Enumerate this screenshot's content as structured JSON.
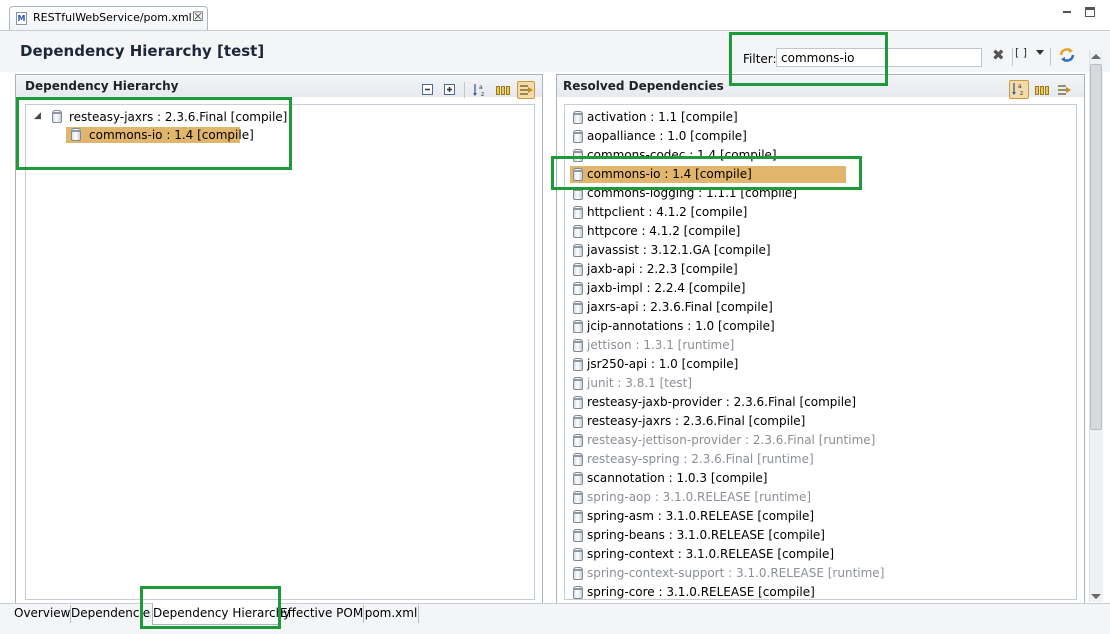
{
  "editor_tab": {
    "title": "RESTfulWebService/pom.xml",
    "icon": "maven-pom-icon",
    "icon_letter": "M",
    "close_glyph": "☒"
  },
  "header": {
    "title": "Dependency Hierarchy [test]",
    "filter_label": "Filter:",
    "filter_value": "commons-io",
    "bracket_glyph": "[ ]"
  },
  "left_panel": {
    "title": "Dependency Hierarchy",
    "tree": [
      {
        "label": "resteasy-jaxrs : 2.3.6.Final [compile]",
        "expanded": true,
        "expander": "◢",
        "selected": false
      },
      {
        "label": "commons-io : 1.4 [compile]",
        "selected": true
      }
    ]
  },
  "right_panel": {
    "title": "Resolved Dependencies",
    "items": [
      {
        "label": "activation : 1.1 [compile]",
        "muted": false
      },
      {
        "label": "aopalliance : 1.0 [compile]",
        "muted": false
      },
      {
        "label": "commons-codec : 1.4 [compile]",
        "muted": false
      },
      {
        "label": "commons-io : 1.4 [compile]",
        "muted": false,
        "selected": true
      },
      {
        "label": "commons-logging : 1.1.1 [compile]",
        "muted": false
      },
      {
        "label": "httpclient : 4.1.2 [compile]",
        "muted": false
      },
      {
        "label": "httpcore : 4.1.2 [compile]",
        "muted": false
      },
      {
        "label": "javassist : 3.12.1.GA [compile]",
        "muted": false
      },
      {
        "label": "jaxb-api : 2.2.3 [compile]",
        "muted": false
      },
      {
        "label": "jaxb-impl : 2.2.4 [compile]",
        "muted": false
      },
      {
        "label": "jaxrs-api : 2.3.6.Final [compile]",
        "muted": false
      },
      {
        "label": "jcip-annotations : 1.0 [compile]",
        "muted": false
      },
      {
        "label": "jettison : 1.3.1 [runtime]",
        "muted": true
      },
      {
        "label": "jsr250-api : 1.0 [compile]",
        "muted": false
      },
      {
        "label": "junit : 3.8.1 [test]",
        "muted": true
      },
      {
        "label": "resteasy-jaxb-provider : 2.3.6.Final [compile]",
        "muted": false
      },
      {
        "label": "resteasy-jaxrs : 2.3.6.Final [compile]",
        "muted": false
      },
      {
        "label": "resteasy-jettison-provider : 2.3.6.Final [runtime]",
        "muted": true
      },
      {
        "label": "resteasy-spring : 2.3.6.Final [runtime]",
        "muted": true
      },
      {
        "label": "scannotation : 1.0.3 [compile]",
        "muted": false
      },
      {
        "label": "spring-aop : 3.1.0.RELEASE [runtime]",
        "muted": true
      },
      {
        "label": "spring-asm : 3.1.0.RELEASE [compile]",
        "muted": false
      },
      {
        "label": "spring-beans : 3.1.0.RELEASE [compile]",
        "muted": false
      },
      {
        "label": "spring-context : 3.1.0.RELEASE [compile]",
        "muted": false
      },
      {
        "label": "spring-context-support : 3.1.0.RELEASE [runtime]",
        "muted": true
      },
      {
        "label": "spring-core : 3.1.0.RELEASE [compile]",
        "muted": false
      }
    ]
  },
  "bottom_tabs": [
    {
      "label": "Overview",
      "active": false
    },
    {
      "label": "Dependencies",
      "active": false
    },
    {
      "label": "Dependency Hierarchy",
      "active": true
    },
    {
      "label": "Effective POM",
      "active": false
    },
    {
      "label": "pom.xml",
      "active": false
    }
  ],
  "colors": {
    "selection": "#e2b56d",
    "muted_text": "#8a8f96",
    "annotation_green": "#1e9a3a",
    "panel_border": "#a8b3c0"
  }
}
